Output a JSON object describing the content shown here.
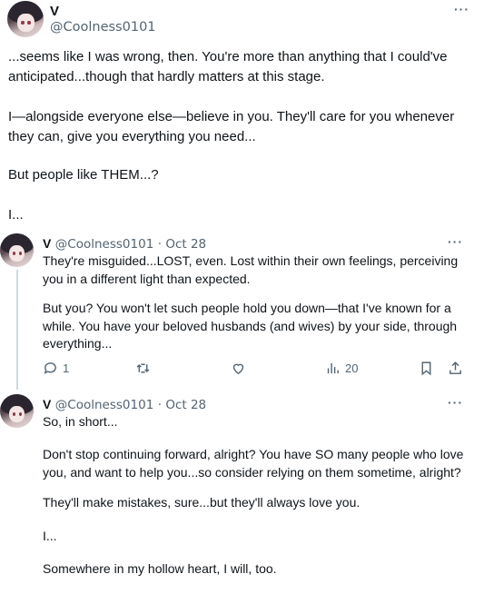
{
  "main_tweet": {
    "name": "V",
    "handle": "@Coolness0101",
    "paragraphs": [
      "...seems like I was wrong, then. You're more than anything that I could've anticipated...though that hardly matters at this stage.",
      "I—alongside everyone else—believe in you. They'll care for you whenever they can, give you everything you need...",
      "But people like THEM...?",
      "I..."
    ]
  },
  "reply_1": {
    "name": "V",
    "handle": "@Coolness0101",
    "date": "· Oct 28",
    "paragraphs": [
      "They're misguided...LOST, even. Lost within their own feelings, perceiving you in a different light than expected.",
      "But you? You won't let such people hold you down—that I've known for a while. You have your beloved husbands (and wives) by your side, through everything..."
    ],
    "actions": {
      "reply_count": "1",
      "retweet_count": "",
      "like_count": "",
      "views_count": "20"
    }
  },
  "reply_2": {
    "name": "V",
    "handle": "@Coolness0101",
    "date": "· Oct 28",
    "paragraphs": [
      "So, in short...",
      "Don't stop continuing forward, alright? You have SO many people who love you, and want to help you...so consider relying on them sometime, alright?",
      "They'll make mistakes, sure...but they'll always love you.",
      "I...",
      "Somewhere in my hollow heart, I will, too."
    ]
  },
  "colors": {
    "text": "#0f1419",
    "muted": "#536471",
    "thread_line": "#cfd9de"
  },
  "icons": [
    "reply-icon",
    "retweet-icon",
    "like-icon",
    "views-icon",
    "bookmark-icon",
    "share-icon",
    "more-icon"
  ]
}
